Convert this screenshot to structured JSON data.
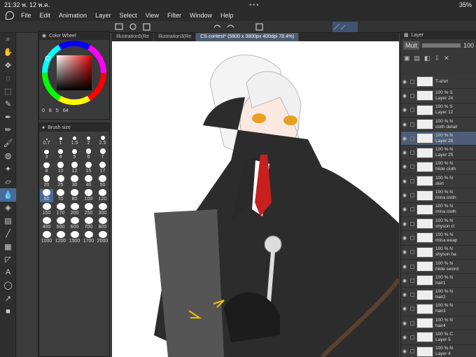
{
  "status": {
    "time": "21:32",
    "date": "พ. 12 พ.ค.",
    "battery": "35%"
  },
  "menu": [
    "File",
    "Edit",
    "Animation",
    "Layer",
    "Select",
    "View",
    "Filter",
    "Window",
    "Help"
  ],
  "tabs": [
    "Illustration5(Re",
    "Illustration3(Re",
    "CS contest* (5600 x 3800px 400dpi 78.4%)"
  ],
  "color_panel": {
    "title": "Color Wheel",
    "values": [
      "0",
      "8",
      "5",
      "64"
    ]
  },
  "brush_panel": {
    "title": "Brush size"
  },
  "brush_sizes": [
    "0.7",
    "1",
    "1.5",
    "2",
    "2.5",
    "3",
    "4",
    "5",
    "6",
    "7",
    "8",
    "10",
    "12",
    "15",
    "17",
    "20",
    "25",
    "30",
    "40",
    "50",
    "60",
    "70",
    "80",
    "100",
    "120",
    "150",
    "170",
    "200",
    "250",
    "300",
    "400",
    "500",
    "600",
    "700",
    "800",
    "1000",
    "1200",
    "1500",
    "1700",
    "2000"
  ],
  "layer_panel": {
    "title": "Layer",
    "opacity": "100",
    "blend": "Mult"
  },
  "layers": [
    {
      "line1": "T-shirt",
      "line2": ""
    },
    {
      "line1": "100 % S",
      "line2": "Layer 24"
    },
    {
      "line1": "100 % S",
      "line2": "Layer 12"
    },
    {
      "line1": "100 % N",
      "line2": "cloth detail"
    },
    {
      "line1": "100 % N",
      "line2": "Layer 26"
    },
    {
      "line1": "100 % N",
      "line2": "Layer 25"
    },
    {
      "line1": "100 % N",
      "line2": "hilde cloth"
    },
    {
      "line1": "100 % N",
      "line2": "skirt"
    },
    {
      "line1": "100 % N",
      "line2": "mina cloth"
    },
    {
      "line1": "100 % N",
      "line2": "mina cloth"
    },
    {
      "line1": "100 % N",
      "line2": "shyson cl"
    },
    {
      "line1": "100 % N",
      "line2": "mina weap"
    },
    {
      "line1": "100 % N",
      "line2": "shyson ha"
    },
    {
      "line1": "100 % N",
      "line2": "hilde sword"
    },
    {
      "line1": "100 % N",
      "line2": "hair1"
    },
    {
      "line1": "100 % N",
      "line2": "hair2"
    },
    {
      "line1": "100 % N",
      "line2": "hair3"
    },
    {
      "line1": "100 % N",
      "line2": "hair4"
    },
    {
      "line1": "100 % C",
      "line2": "Layer 5"
    },
    {
      "line1": "100 % N",
      "line2": "Layer 4"
    }
  ]
}
